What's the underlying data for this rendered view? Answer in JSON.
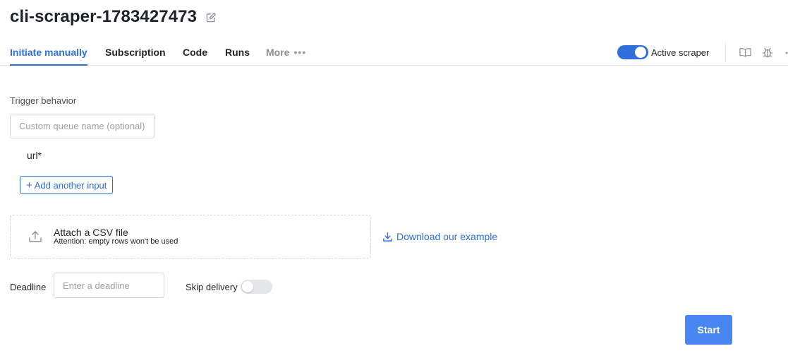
{
  "header": {
    "title": "cli-scraper-1783427473",
    "edit_icon": "pencil-square-icon"
  },
  "tabs": [
    {
      "label": "Initiate manually",
      "active": true
    },
    {
      "label": "Subscription",
      "active": false
    },
    {
      "label": "Code",
      "active": false
    },
    {
      "label": "Runs",
      "active": false
    },
    {
      "label": "More",
      "active": false
    }
  ],
  "more_icon": "ellipsis-icon",
  "toolbar": {
    "active_scraper_label": "Active scraper",
    "active_scraper_on": true,
    "icons": [
      "book-icon",
      "bug-icon"
    ]
  },
  "form": {
    "trigger_behavior_label": "Trigger behavior",
    "queue_placeholder": "Custom queue name (optional)",
    "url_label": "url*",
    "add_input_label": "Add another input",
    "csv": {
      "title": "Attach a CSV file",
      "subtitle": "Attention: empty rows won't be used",
      "icon": "upload-icon"
    },
    "download_label": "Download our example",
    "deadline_label": "Deadline",
    "deadline_placeholder": "Enter a deadline",
    "skip_delivery_label": "Skip delivery",
    "skip_delivery_on": false,
    "start_label": "Start"
  },
  "colors": {
    "accent": "#2f6fdc",
    "primary_button": "#4a86f2",
    "border": "#d3d6db"
  }
}
